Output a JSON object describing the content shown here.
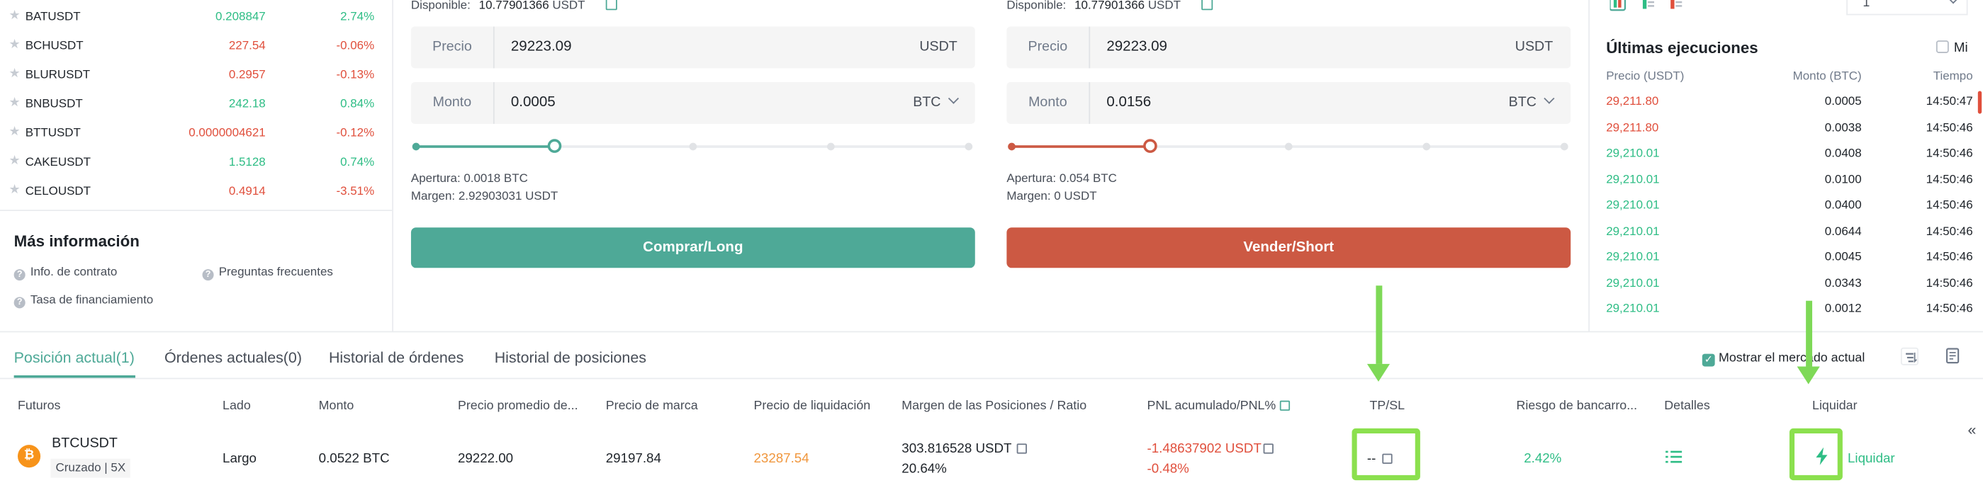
{
  "markets": [
    {
      "symbol": "BATUSDT",
      "price": "0.208847",
      "change": "2.74%",
      "dir": "up"
    },
    {
      "symbol": "BCHUSDT",
      "price": "227.54",
      "change": "-0.06%",
      "dir": "down"
    },
    {
      "symbol": "BLURUSDT",
      "price": "0.2957",
      "change": "-0.13%",
      "dir": "down"
    },
    {
      "symbol": "BNBUSDT",
      "price": "242.18",
      "change": "0.84%",
      "dir": "up"
    },
    {
      "symbol": "BTTUSDT",
      "price": "0.0000004621",
      "change": "-0.12%",
      "dir": "down"
    },
    {
      "symbol": "CAKEUSDT",
      "price": "1.5128",
      "change": "0.74%",
      "dir": "up"
    },
    {
      "symbol": "CELOUSDT",
      "price": "0.4914",
      "change": "-3.51%",
      "dir": "down"
    }
  ],
  "info": {
    "title": "Más información",
    "contract": "Info. de contrato",
    "faq": "Preguntas frecuentes",
    "funding": "Tasa de financiamiento"
  },
  "buy": {
    "available_label": "Disponible:",
    "available_value": "10.77901366",
    "available_unit": "USDT",
    "price_label": "Precio",
    "price_value": "29223.09",
    "price_unit": "USDT",
    "amount_label": "Monto",
    "amount_value": "0.0005",
    "amount_unit": "BTC",
    "slider_percent": 25,
    "open": "Apertura: 0.0018 BTC",
    "margin": "Margen: 2.92903031 USDT",
    "button": "Comprar/Long"
  },
  "sell": {
    "available_label": "Disponible:",
    "available_value": "10.77901366",
    "available_unit": "USDT",
    "price_label": "Precio",
    "price_value": "29223.09",
    "price_unit": "USDT",
    "amount_label": "Monto",
    "amount_value": "0.0156",
    "amount_unit": "BTC",
    "slider_percent": 25,
    "open": "Apertura: 0.054 BTC",
    "margin": "Margen: 0 USDT",
    "button": "Vender/Short"
  },
  "trades": {
    "depth_value": "1",
    "title": "Últimas ejecuciones",
    "mine_label": "Mi",
    "col_price": "Precio (USDT)",
    "col_amount": "Monto (BTC)",
    "col_time": "Tiempo",
    "rows": [
      {
        "price": "29,211.80",
        "amount": "0.0005",
        "time": "14:50:47",
        "dir": "down"
      },
      {
        "price": "29,211.80",
        "amount": "0.0038",
        "time": "14:50:46",
        "dir": "down"
      },
      {
        "price": "29,210.01",
        "amount": "0.0408",
        "time": "14:50:46",
        "dir": "up"
      },
      {
        "price": "29,210.01",
        "amount": "0.0100",
        "time": "14:50:46",
        "dir": "up"
      },
      {
        "price": "29,210.01",
        "amount": "0.0400",
        "time": "14:50:46",
        "dir": "up"
      },
      {
        "price": "29,210.01",
        "amount": "0.0644",
        "time": "14:50:46",
        "dir": "up"
      },
      {
        "price": "29,210.01",
        "amount": "0.0045",
        "time": "14:50:46",
        "dir": "up"
      },
      {
        "price": "29,210.01",
        "amount": "0.0343",
        "time": "14:50:46",
        "dir": "up"
      },
      {
        "price": "29,210.01",
        "amount": "0.0012",
        "time": "14:50:46",
        "dir": "up"
      }
    ]
  },
  "tabs": [
    {
      "label": "Posición actual(1)",
      "active": true
    },
    {
      "label": "Órdenes actuales(0)",
      "active": false
    },
    {
      "label": "Historial de órdenes",
      "active": false
    },
    {
      "label": "Historial de posiciones",
      "active": false
    }
  ],
  "show_current_market": "Mostrar el mercado actual",
  "columns": {
    "futures": "Futuros",
    "side": "Lado",
    "amount": "Monto",
    "avg_price": "Precio promedio de...",
    "mark_price": "Precio de marca",
    "liq_price": "Precio de liquidación",
    "margin_ratio": "Margen de las Posiciones / Ratio",
    "pnl": "PNL acumulado/PNL%",
    "tpsl": "TP/SL",
    "risk": "Riesgo de bancarro...",
    "details": "Detalles",
    "liquidate": "Liquidar"
  },
  "position": {
    "symbol": "BTCUSDT",
    "mode": "Cruzado | 5X",
    "side": "Largo",
    "amount": "0.0522 BTC",
    "avg_price": "29222.00",
    "mark_price": "29197.84",
    "liq_price": "23287.54",
    "margin": "303.816528 USDT",
    "ratio": "20.64%",
    "pnl": "-1.48637902 USDT",
    "pnl_pct": "-0.48%",
    "tpsl": "--",
    "risk": "2.42%",
    "liquidate": "Liquidar"
  },
  "colors": {
    "buy": "#4ea997",
    "sell": "#cc5943",
    "up": "#2ebd85",
    "down": "#e04f3c",
    "annotation": "#7ed957",
    "liq_price": "#f0963c"
  }
}
